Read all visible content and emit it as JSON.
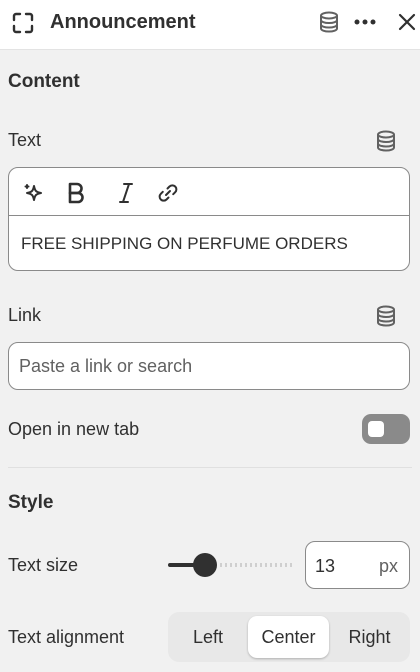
{
  "header": {
    "title": "Announcement",
    "icons": [
      "focus-frame-icon",
      "database-icon",
      "more-icon",
      "close-icon"
    ]
  },
  "content_section": {
    "title": "Content"
  },
  "text_field": {
    "label": "Text",
    "value": "FREE SHIPPING ON PERFUME ORDERS",
    "toolbar_icons": [
      "sparkle-icon",
      "bold-icon",
      "italic-icon",
      "link-icon"
    ]
  },
  "link_field": {
    "label": "Link",
    "placeholder": "Paste a link or search",
    "value": ""
  },
  "open_new_tab": {
    "label": "Open in new tab",
    "enabled": false
  },
  "style_section": {
    "title": "Style"
  },
  "text_size": {
    "label": "Text size",
    "value": "13",
    "unit": "px"
  },
  "text_alignment": {
    "label": "Text alignment",
    "options": [
      "Left",
      "Center",
      "Right"
    ],
    "selected": "Center"
  },
  "colors": {
    "background": "#f1f1f1",
    "text": "#303030",
    "toggle_off": "#8a8a8a",
    "border": "#8a8a8a"
  }
}
